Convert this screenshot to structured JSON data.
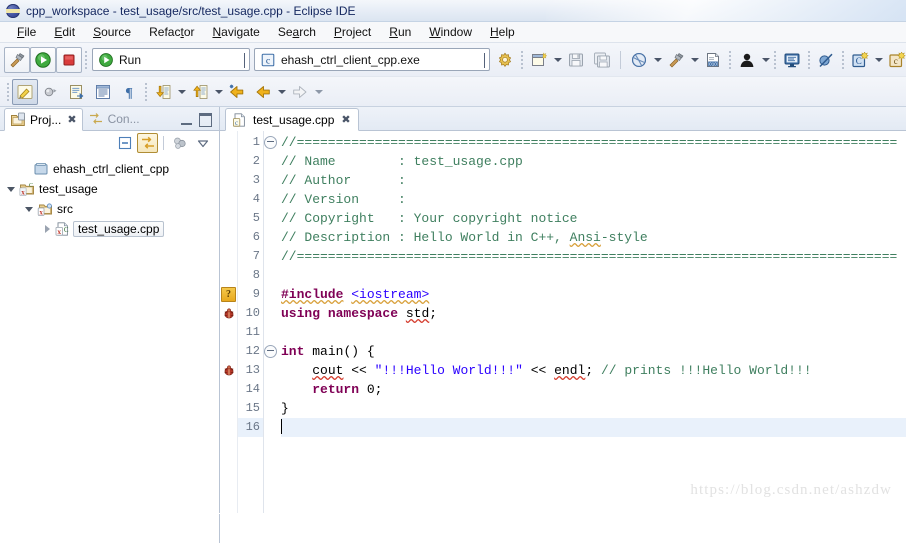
{
  "window": {
    "title": "cpp_workspace - test_usage/src/test_usage.cpp - Eclipse IDE",
    "logo_icon": "eclipse-logo-icon"
  },
  "menubar": {
    "items": [
      {
        "label": "File",
        "mnemonic": "F"
      },
      {
        "label": "Edit",
        "mnemonic": "E"
      },
      {
        "label": "Source",
        "mnemonic": "S"
      },
      {
        "label": "Refactor",
        "mnemonic": "t"
      },
      {
        "label": "Navigate",
        "mnemonic": "N"
      },
      {
        "label": "Search",
        "mnemonic": "a"
      },
      {
        "label": "Project",
        "mnemonic": "P"
      },
      {
        "label": "Run",
        "mnemonic": "R"
      },
      {
        "label": "Window",
        "mnemonic": "W"
      },
      {
        "label": "Help",
        "mnemonic": "H"
      }
    ]
  },
  "toolbar_main": {
    "build_button": {
      "icon": "hammer-build-icon",
      "label": "Build"
    },
    "run_button": {
      "icon": "run-play-icon",
      "label": "Run"
    },
    "stop_button": {
      "icon": "stop-square-icon",
      "label": "Terminate"
    },
    "launch_config_combo": {
      "icon": "run-play-icon",
      "value": "Run",
      "caret": "chevron-down-icon"
    },
    "launch_target_combo": {
      "icon": "c-file-icon",
      "value": "ehash_ctrl_client_cpp.exe",
      "caret": "chevron-down-icon"
    },
    "launch_settings_button": {
      "icon": "gear-icon"
    },
    "new_button": {
      "icon": "new-file-icon",
      "caret": "chevron-down-icon"
    },
    "save_button": {
      "icon": "save-floppy-icon"
    },
    "save_all_button": {
      "icon": "save-all-icon"
    },
    "debug_button": {
      "icon": "debug-bug-icon",
      "caret": "chevron-down-icon"
    },
    "build_all_button": {
      "icon": "hammer-build-icon",
      "caret": "chevron-down-icon"
    },
    "binary_button": {
      "icon": "binary-010-file-icon"
    },
    "profile_button": {
      "icon": "person-profile-icon",
      "caret": "chevron-down-icon"
    },
    "console_button": {
      "icon": "console-monitor-icon"
    },
    "skip_breakpoints_button": {
      "icon": "skip-breakpoints-icon"
    },
    "new_cpp_class_button": {
      "icon": "new-cpp-class-icon",
      "caret": "chevron-down-icon"
    },
    "new_c_class_button": {
      "icon": "new-c-class-icon"
    }
  },
  "toolbar_edit": {
    "toggle_mark_occurrences": {
      "icon": "highlight-pen-icon",
      "state": "pressed"
    },
    "open_declaration": {
      "icon": "open-declaration-icon"
    },
    "open_call_hierarchy": {
      "icon": "open-element-icon"
    },
    "open_type_hierarchy": {
      "icon": "type-hierarchy-icon"
    },
    "show_whitespace": {
      "icon": "pilcrow-icon"
    },
    "next_annotation": {
      "icon": "next-annotation-down-icon",
      "caret": "chevron-down-icon"
    },
    "previous_annotation": {
      "icon": "previous-annotation-up-icon",
      "caret": "chevron-down-icon"
    },
    "last_edit_location": {
      "icon": "last-edit-location-icon"
    },
    "back": {
      "icon": "back-arrow-icon",
      "caret": "chevron-down-icon"
    },
    "forward": {
      "icon": "forward-arrow-icon",
      "caret": "chevron-down-icon"
    }
  },
  "project_explorer": {
    "tabs": [
      {
        "label": "Proj...",
        "icon": "project-explorer-icon",
        "active": true,
        "close": "close-icon"
      },
      {
        "label": "Con...",
        "icon": "console-view-icon",
        "active": false,
        "close": "close-icon"
      }
    ],
    "window_controls": {
      "minimize": "minimize-icon",
      "maximize": "maximize-icon"
    },
    "view_toolbar": [
      {
        "name": "collapse-all-button",
        "icon": "collapse-all-icon",
        "active": false
      },
      {
        "name": "link-with-editor-button",
        "icon": "link-with-editor-icon",
        "active": true
      },
      {
        "name": "filter-button",
        "icon": "filter-bubbles-icon",
        "active": false
      },
      {
        "name": "view-menu-button",
        "icon": "view-menu-chevron-icon",
        "active": false
      }
    ],
    "tree": [
      {
        "label": "ehash_ctrl_client_cpp",
        "icon": "closed-project-folder-icon",
        "indent": 1,
        "twisty": "none",
        "selected": false
      },
      {
        "label": "test_usage",
        "icon": "cpp-project-icon",
        "indent": 0,
        "twisty": "expanded",
        "selected": false
      },
      {
        "label": "src",
        "icon": "source-folder-icon",
        "indent": 1,
        "twisty": "expanded",
        "selected": false
      },
      {
        "label": "test_usage.cpp",
        "icon": "cpp-source-file-icon",
        "indent": 2,
        "twisty": "collapsed",
        "selected": true
      }
    ]
  },
  "editor": {
    "tabs": [
      {
        "label": "test_usage.cpp",
        "icon": "cpp-source-file-icon",
        "active": true,
        "close": "close-icon"
      }
    ],
    "lines": [
      {
        "no": 1,
        "marker": null,
        "fold": "collapse",
        "current": false,
        "tokens": [
          {
            "t": "//=============================================================================",
            "c": "c-comment"
          }
        ]
      },
      {
        "no": 2,
        "marker": null,
        "fold": null,
        "current": false,
        "tokens": [
          {
            "t": "// Name        : test_usage.cpp",
            "c": "c-comment"
          }
        ]
      },
      {
        "no": 3,
        "marker": null,
        "fold": null,
        "current": false,
        "tokens": [
          {
            "t": "// Author      :",
            "c": "c-comment"
          }
        ]
      },
      {
        "no": 4,
        "marker": null,
        "fold": null,
        "current": false,
        "tokens": [
          {
            "t": "// Version     :",
            "c": "c-comment"
          }
        ]
      },
      {
        "no": 5,
        "marker": null,
        "fold": null,
        "current": false,
        "tokens": [
          {
            "t": "// Copyright   : Your copyright notice",
            "c": "c-comment"
          }
        ]
      },
      {
        "no": 6,
        "marker": null,
        "fold": null,
        "current": false,
        "tokens": [
          {
            "t": "// Description : Hello World in C++, ",
            "c": "c-comment"
          },
          {
            "t": "Ansi",
            "c": "c-comment sq-y"
          },
          {
            "t": "-style",
            "c": "c-comment"
          }
        ]
      },
      {
        "no": 7,
        "marker": null,
        "fold": null,
        "current": false,
        "tokens": [
          {
            "t": "//=============================================================================",
            "c": "c-comment"
          }
        ]
      },
      {
        "no": 8,
        "marker": null,
        "fold": null,
        "current": false,
        "tokens": []
      },
      {
        "no": 9,
        "marker": "warning",
        "fold": null,
        "current": false,
        "tokens": [
          {
            "t": "#include",
            "c": "c-pp sq-y"
          },
          {
            "t": " ",
            "c": "c-plain"
          },
          {
            "t": "<iostream>",
            "c": "c-inc sq-y"
          }
        ]
      },
      {
        "no": 10,
        "marker": "bug",
        "fold": null,
        "current": false,
        "tokens": [
          {
            "t": "using",
            "c": "c-kw"
          },
          {
            "t": " ",
            "c": "c-plain"
          },
          {
            "t": "namespace",
            "c": "c-kw"
          },
          {
            "t": " ",
            "c": "c-plain"
          },
          {
            "t": "std",
            "c": "c-plain sq"
          },
          {
            "t": ";",
            "c": "c-plain"
          }
        ]
      },
      {
        "no": 11,
        "marker": null,
        "fold": null,
        "current": false,
        "tokens": []
      },
      {
        "no": 12,
        "marker": null,
        "fold": "collapse",
        "current": false,
        "tokens": [
          {
            "t": "int",
            "c": "c-kw"
          },
          {
            "t": " ",
            "c": "c-plain"
          },
          {
            "t": "main",
            "c": "c-plain"
          },
          {
            "t": "() {",
            "c": "c-plain"
          }
        ]
      },
      {
        "no": 13,
        "marker": "bug",
        "fold": null,
        "current": false,
        "tokens": [
          {
            "t": "    ",
            "c": "c-plain"
          },
          {
            "t": "cout",
            "c": "c-plain sq"
          },
          {
            "t": " << ",
            "c": "c-plain"
          },
          {
            "t": "\"!!!Hello World!!!\"",
            "c": "c-str"
          },
          {
            "t": " << ",
            "c": "c-plain"
          },
          {
            "t": "endl",
            "c": "c-plain sq"
          },
          {
            "t": "; ",
            "c": "c-plain"
          },
          {
            "t": "// prints !!!Hello World!!!",
            "c": "c-comment"
          }
        ]
      },
      {
        "no": 14,
        "marker": null,
        "fold": null,
        "current": false,
        "tokens": [
          {
            "t": "    ",
            "c": "c-plain"
          },
          {
            "t": "return",
            "c": "c-kw"
          },
          {
            "t": " ",
            "c": "c-plain"
          },
          {
            "t": "0",
            "c": "c-num"
          },
          {
            "t": ";",
            "c": "c-plain"
          }
        ]
      },
      {
        "no": 15,
        "marker": null,
        "fold": null,
        "current": false,
        "tokens": [
          {
            "t": "}",
            "c": "c-plain"
          }
        ]
      },
      {
        "no": 16,
        "marker": null,
        "fold": null,
        "current": true,
        "tokens": [],
        "caret": true
      }
    ]
  },
  "watermark": {
    "text": "https://blog.csdn.net/ashzdw"
  },
  "colors": {
    "comment": "#3f7f5f",
    "keyword": "#7f0055",
    "string": "#2a00ff",
    "include": "#2a00ff",
    "current_line": "#e9f1fb",
    "accent_border": "#b9c4d4",
    "title_text": "#13265e"
  }
}
